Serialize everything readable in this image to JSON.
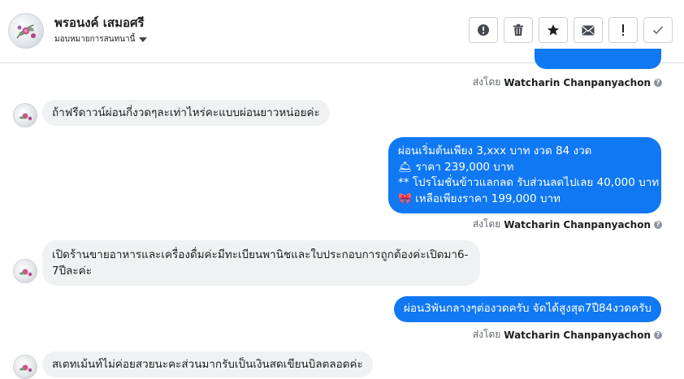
{
  "header": {
    "name": "พรอนงค์ เสมอศรี",
    "assign_label": "มอบหมายการสนทนานี้",
    "buttons": [
      {
        "name": "spam-button",
        "icon": "alert-circle-icon"
      },
      {
        "name": "delete-button",
        "icon": "trash-icon"
      },
      {
        "name": "star-button",
        "icon": "star-icon"
      },
      {
        "name": "mark-unread-button",
        "icon": "envelope-icon"
      },
      {
        "name": "follow-up-button",
        "icon": "exclamation-icon"
      },
      {
        "name": "done-button",
        "icon": "check-icon"
      }
    ]
  },
  "messages": {
    "sent_by_prefix": "ส่งโดย",
    "agent_name": "Watcharin Chanpanyachon",
    "m1": "ถ้าฟรีดาวน์ผ่อนกี่งวดๆละเท่าไหร่คะแบบผ่อนยาวหน่อยค่ะ",
    "m2": {
      "line1": "ผ่อนเริ่มต้นเพียง 3,xxx บาท งวด 84 งวด",
      "line2_emoji": "🛎",
      "line2": "ราคา 239,000 บาท",
      "line3": "** โปรโมชั่นข้าวแลกลด รับส่วนลดไปเลย 40,000 บาท",
      "line4_emoji": "🎀",
      "line4": "เหลือเพียงราคา 199,000 บาท"
    },
    "m3_line1": "เปิดร้านขายอาหารและเครื่องดื่มค่ะมีทะเบียนพานิชและใบประกอบการถูกต้องค่ะเปิดมา6-",
    "m3_line2": "7ปีละค่ะ",
    "m4": "ผ่อน3พันกลางๆต่องวดครับ จัดได้สูงสุด7ปี84งวดครับ",
    "m5": "สเตทเม้นท์ไม่ค่อยสวยนะคะส่วนมากรับเป็นเงินสดเขียนบิลตลอดค่ะ"
  },
  "colors": {
    "outgoing": "#1078f3",
    "incoming": "#eff1f3"
  }
}
